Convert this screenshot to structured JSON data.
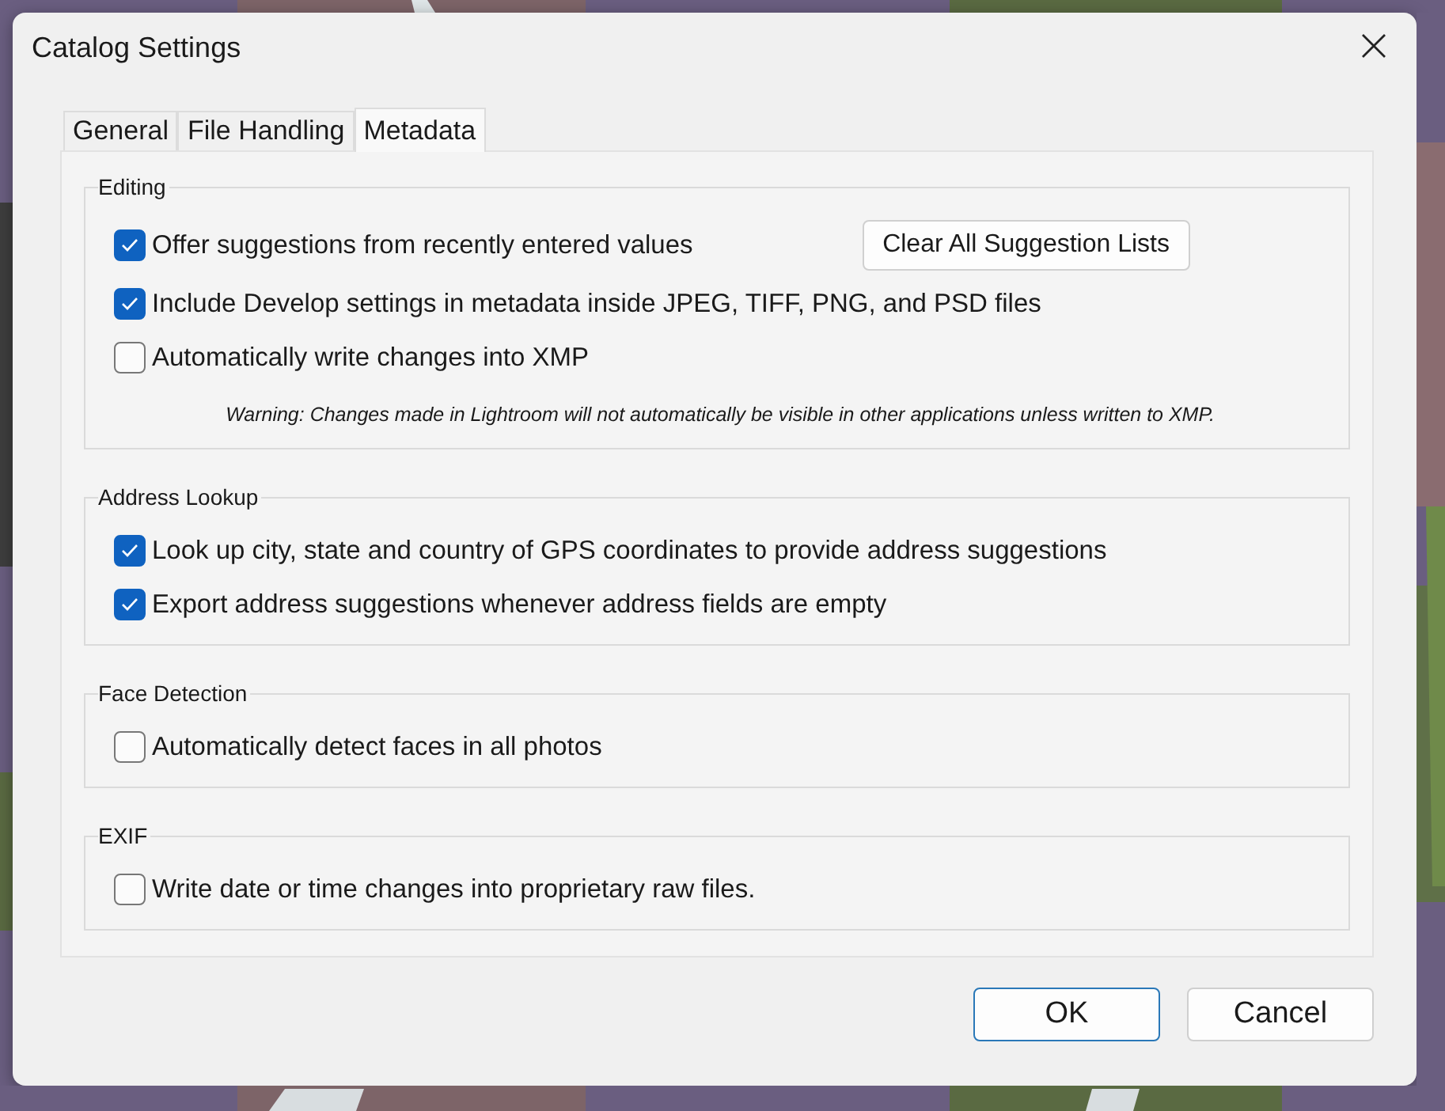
{
  "window": {
    "title": "Catalog Settings"
  },
  "tabs": [
    {
      "label": "General",
      "selected": false
    },
    {
      "label": "File Handling",
      "selected": false
    },
    {
      "label": "Metadata",
      "selected": true
    }
  ],
  "groups": [
    {
      "title": "Editing",
      "items": [
        {
          "kind": "checkbox",
          "label": "Offer suggestions from recently entered values",
          "checked": true,
          "button": "Clear All Suggestion Lists"
        },
        {
          "kind": "checkbox",
          "label": "Include Develop settings in metadata inside JPEG, TIFF, PNG, and PSD files",
          "checked": true
        },
        {
          "kind": "checkbox",
          "label": "Automatically write changes into XMP",
          "checked": false
        },
        {
          "kind": "note",
          "text": "Warning: Changes made in Lightroom will not automatically be visible in other applications unless written to XMP."
        }
      ]
    },
    {
      "title": "Address Lookup",
      "items": [
        {
          "kind": "checkbox",
          "label": "Look up city, state and country of GPS coordinates to provide address suggestions",
          "checked": true
        },
        {
          "kind": "checkbox",
          "label": "Export address suggestions whenever address fields are empty",
          "checked": true
        }
      ]
    },
    {
      "title": "Face Detection",
      "items": [
        {
          "kind": "checkbox",
          "label": "Automatically detect faces in all photos",
          "checked": false
        }
      ]
    },
    {
      "title": "EXIF",
      "items": [
        {
          "kind": "checkbox",
          "label": "Write date or time changes into proprietary raw files.",
          "checked": false
        }
      ]
    }
  ],
  "buttons": [
    {
      "label": "OK",
      "default": true
    },
    {
      "label": "Cancel",
      "default": false
    }
  ]
}
